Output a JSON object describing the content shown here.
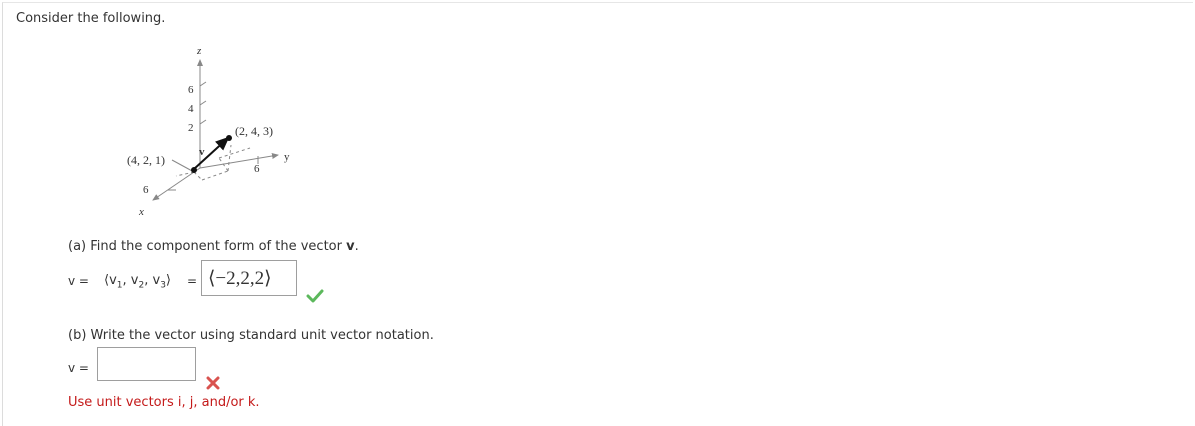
{
  "intro": "Consider the following.",
  "figure": {
    "axis_z": "z",
    "axis_y": "y",
    "axis_x": "x",
    "z_ticks": [
      "6",
      "4",
      "2"
    ],
    "y_tick": "6",
    "x_tick": "6",
    "point_tip": "(2, 4, 3)",
    "point_tail": "(4, 2, 1)",
    "vector": "v"
  },
  "part_a": {
    "prompt": "(a) Find the component form of the vector ",
    "prompt_bold": "v",
    "prompt_end": ".",
    "v_label": "v =",
    "components_open": "⟨",
    "c1": "v",
    "c1_sub": "1",
    "c2": "v",
    "c2_sub": "2",
    "c3": "v",
    "c3_sub": "3",
    "components_close": "⟩",
    "equals": "=",
    "answer": "⟨−2,2,2⟩",
    "status": "correct",
    "status_color": "#5cb85c"
  },
  "part_b": {
    "prompt": "(b) Write the vector using standard unit vector notation.",
    "v_label": "v =",
    "answer": "",
    "status": "incorrect",
    "status_color": "#d9534f",
    "hint": "Use unit vectors i, j, and/or k."
  }
}
